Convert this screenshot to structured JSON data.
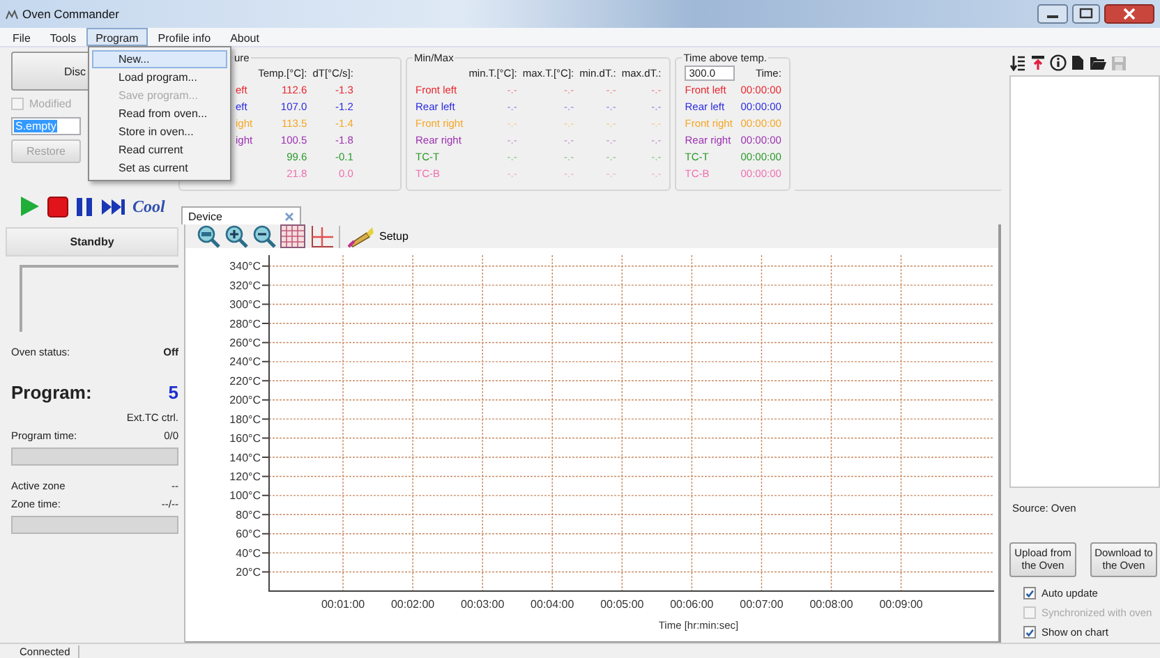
{
  "window": {
    "title": "Oven Commander"
  },
  "menu_bar": [
    {
      "label": "File",
      "selected": false
    },
    {
      "label": "Tools",
      "selected": false
    },
    {
      "label": "Program",
      "selected": true
    },
    {
      "label": "Profile info",
      "selected": false
    },
    {
      "label": "About",
      "selected": false
    }
  ],
  "open_menu": {
    "items": [
      {
        "label": "New...",
        "selected": true,
        "disabled": false
      },
      {
        "label": "Load program...",
        "selected": false,
        "disabled": false
      },
      {
        "label": "Save program...",
        "selected": false,
        "disabled": true
      },
      {
        "label": "Read from oven...",
        "selected": false,
        "disabled": false
      },
      {
        "label": "Store in oven...",
        "selected": false,
        "disabled": false
      },
      {
        "label": "Read current",
        "selected": false,
        "disabled": false
      },
      {
        "label": "Set as current",
        "selected": false,
        "disabled": false
      }
    ]
  },
  "controls": {
    "disconnect_button": "Disc",
    "modified": {
      "label": "Modified",
      "checked": false,
      "disabled": true
    },
    "profile_field": {
      "value": "S.empty"
    },
    "restore_button": "Restore"
  },
  "temperature": {
    "title": "ure",
    "columns": [
      "Temp.[°C]:",
      "dT[°C/s]:"
    ],
    "rows": [
      {
        "name": "eft",
        "color": "#e8242c",
        "temp": "112.6",
        "dt": "-1.3"
      },
      {
        "name": "eft",
        "color": "#2a2ae0",
        "temp": "107.0",
        "dt": "-1.2"
      },
      {
        "name": "ight",
        "color": "#f5a623",
        "temp": "113.5",
        "dt": "-1.4"
      },
      {
        "name": "ight",
        "color": "#9b30b0",
        "temp": "100.5",
        "dt": "-1.8"
      },
      {
        "color": "#2a9a2a",
        "temp": "99.6",
        "dt": "-0.1"
      },
      {
        "color": "#f06fb0",
        "temp": "21.8",
        "dt": "0.0"
      }
    ]
  },
  "min_max": {
    "title": "Min/Max",
    "columns": [
      "min.T.[°C]:",
      "max.T.[°C]:",
      "min.dT.:",
      "max.dT.:"
    ],
    "rows": [
      {
        "name": "Front left",
        "color": "#e8242c",
        "values": [
          "-.-",
          "-.-",
          "-.-",
          "-.-"
        ]
      },
      {
        "name": "Rear left",
        "color": "#2a2ae0",
        "values": [
          "-.-",
          "-.-",
          "-.-",
          "-.-"
        ]
      },
      {
        "name": "Front right",
        "color": "#f5a623",
        "values": [
          "-.-",
          "-.-",
          "-.-",
          "-.-"
        ]
      },
      {
        "name": "Rear right",
        "color": "#9b30b0",
        "values": [
          "-.-",
          "-.-",
          "-.-",
          "-.-"
        ]
      },
      {
        "name": "TC-T",
        "color": "#2a9a2a",
        "values": [
          "-.-",
          "-.-",
          "-.-",
          "-.-"
        ]
      },
      {
        "name": "TC-B",
        "color": "#f06fb0",
        "values": [
          "-.-",
          "-.-",
          "-.-",
          "-.-"
        ]
      }
    ]
  },
  "time_above": {
    "title": "Time above temp.",
    "threshold": "300.0",
    "column": "Time:",
    "rows": [
      {
        "name": "Front left",
        "color": "#e8242c",
        "time": "00:00:00"
      },
      {
        "name": "Rear left",
        "color": "#2a2ae0",
        "time": "00:00:00"
      },
      {
        "name": "Front right",
        "color": "#f5a623",
        "time": "00:00:00"
      },
      {
        "name": "Rear right",
        "color": "#9b30b0",
        "time": "00:00:00"
      },
      {
        "name": "TC-T",
        "color": "#2a9a2a",
        "time": "00:00:00"
      },
      {
        "name": "TC-B",
        "color": "#f06fb0",
        "time": "00:00:00"
      }
    ]
  },
  "cool_button": "Cool",
  "document_tabs": [
    {
      "label": "Device",
      "selected": true
    }
  ],
  "status_panel": {
    "state": "Standby",
    "oven_status_label": "Oven status:",
    "oven_status": "Off",
    "program_label": "Program:",
    "program_number": "5",
    "control_mode": "Ext.TC ctrl.",
    "program_time_label": "Program time:",
    "program_time": "0/0",
    "program_progress": {
      "level": 0
    },
    "active_zone_label": "Active  zone",
    "active_zone": "--",
    "zone_time_label": "Zone time:",
    "zone_time": "--/--",
    "zone_progress": {
      "level": 0
    }
  },
  "chart_toolbar": {
    "setup_button": "Setup"
  },
  "chart": {
    "chart_data": {
      "type": "line",
      "grid": true,
      "xlabel": "Time [hr:min:sec]",
      "xlim": [
        0,
        620
      ],
      "ylim": [
        0,
        350
      ],
      "xticks": [
        {
          "value": 60,
          "label": "00:01:00"
        },
        {
          "value": 120,
          "label": "00:02:00"
        },
        {
          "value": 180,
          "label": "00:03:00"
        },
        {
          "value": 240,
          "label": "00:04:00"
        },
        {
          "value": 300,
          "label": "00:05:00"
        },
        {
          "value": 360,
          "label": "00:06:00"
        },
        {
          "value": 420,
          "label": "00:07:00"
        },
        {
          "value": 480,
          "label": "00:08:00"
        },
        {
          "value": 540,
          "label": "00:09:00"
        }
      ],
      "yticks": [
        {
          "value": 20,
          "label": "20°C"
        },
        {
          "value": 40,
          "label": "40°C"
        },
        {
          "value": 60,
          "label": "60°C"
        },
        {
          "value": 80,
          "label": "80°C"
        },
        {
          "value": 100,
          "label": "100°C"
        },
        {
          "value": 120,
          "label": "120°C"
        },
        {
          "value": 140,
          "label": "140°C"
        },
        {
          "value": 160,
          "label": "160°C"
        },
        {
          "value": 180,
          "label": "180°C"
        },
        {
          "value": 200,
          "label": "200°C"
        },
        {
          "value": 220,
          "label": "220°C"
        },
        {
          "value": 240,
          "label": "240°C"
        },
        {
          "value": 260,
          "label": "260°C"
        },
        {
          "value": 280,
          "label": "280°C"
        },
        {
          "value": 300,
          "label": "300°C"
        },
        {
          "value": 320,
          "label": "320°C"
        },
        {
          "value": 340,
          "label": "340°C"
        }
      ]
    }
  },
  "right_panel": {
    "source": "Source: Oven",
    "upload_button": "Upload from the Oven",
    "download_button": "Download to the Oven",
    "options": [
      {
        "label": "Auto update",
        "checked": true,
        "disabled": false
      },
      {
        "label": "Synchronized with oven",
        "checked": false,
        "disabled": true
      },
      {
        "label": "Show on chart",
        "checked": true,
        "disabled": false
      }
    ]
  },
  "status_bar": {
    "connection": "Connected"
  }
}
